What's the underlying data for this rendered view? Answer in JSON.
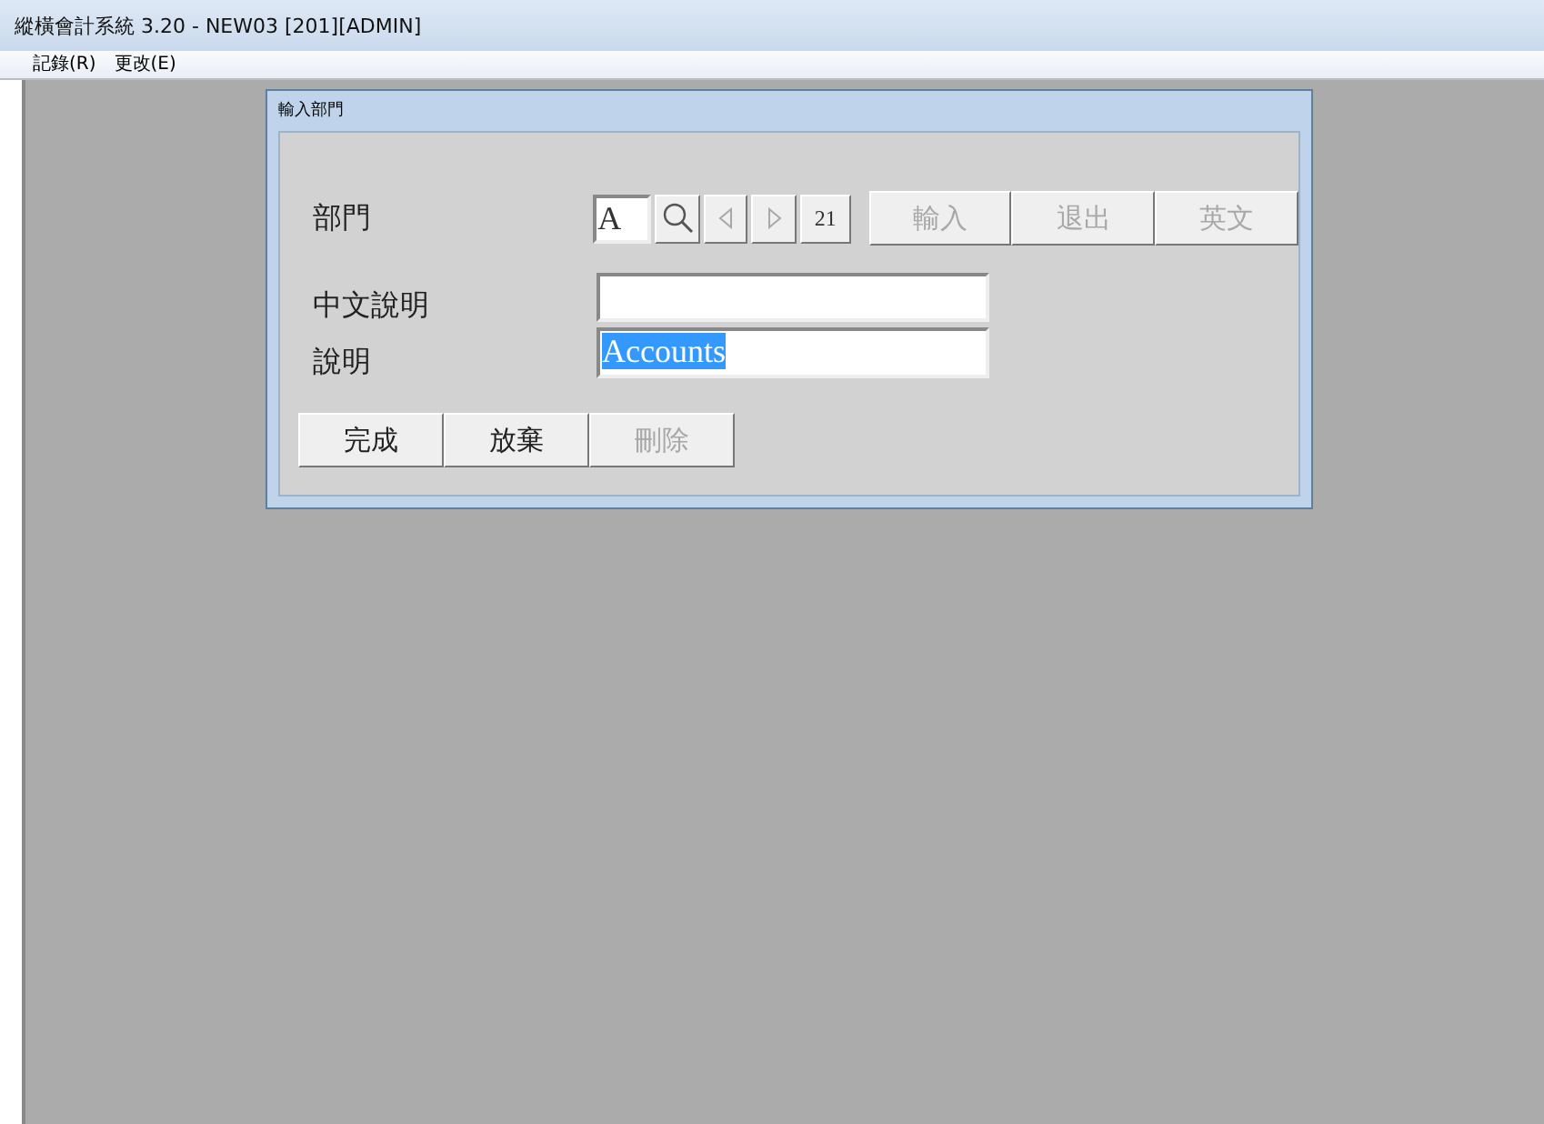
{
  "window": {
    "title": "縱橫會計系統 3.20 - NEW03 [201][ADMIN]"
  },
  "menu": [
    {
      "label": "記錄(R)"
    },
    {
      "label": "更改(E)"
    }
  ],
  "dialog": {
    "title": "輸入部門",
    "department": {
      "label": "部門",
      "value": "A"
    },
    "nav_buttons": [
      {
        "kind": "search",
        "disabled": false
      },
      {
        "kind": "prev",
        "disabled": true
      },
      {
        "kind": "next",
        "disabled": true
      },
      {
        "kind": "text",
        "label": "21",
        "disabled": false
      }
    ],
    "toolbar_buttons": [
      {
        "label": "輸入",
        "disabled": true
      },
      {
        "label": "退出",
        "disabled": true
      },
      {
        "label": "英文",
        "disabled": true
      }
    ],
    "fields": [
      {
        "label": "中文說明",
        "selected": false
      },
      {
        "label": "說明",
        "value": "Accounts",
        "selected": true
      }
    ],
    "buttons": [
      {
        "label": "完成",
        "disabled": false
      },
      {
        "label": "放棄",
        "disabled": false
      },
      {
        "label": "刪除",
        "disabled": true
      }
    ]
  }
}
